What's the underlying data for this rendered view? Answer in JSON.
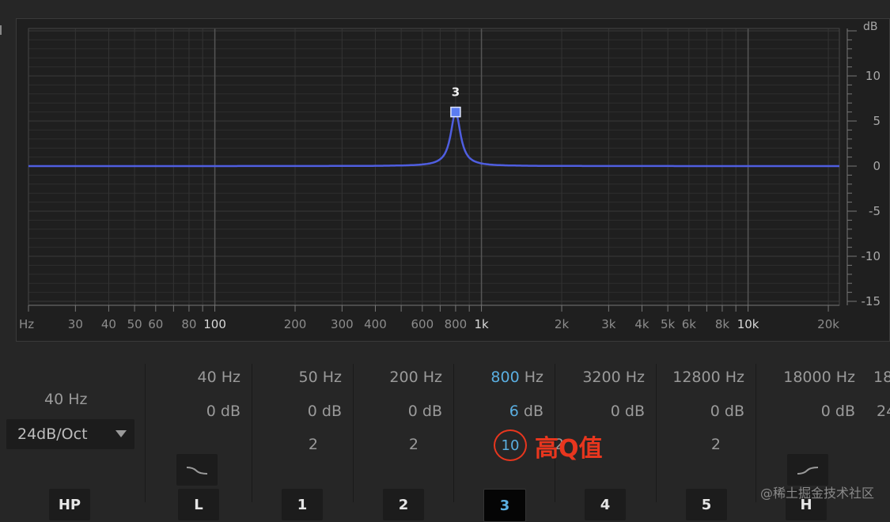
{
  "graph": {
    "db_unit": "dB",
    "db_ticks": [
      "10",
      "5",
      "0",
      "-5",
      "-10",
      "-15"
    ],
    "hz_unit": "Hz",
    "hz_ticks": [
      "30",
      "40",
      "50",
      "60",
      "80",
      "100",
      "200",
      "300",
      "400",
      "600",
      "800",
      "1k",
      "2k",
      "3k",
      "4k",
      "5k",
      "6k",
      "8k",
      "10k",
      "20k"
    ],
    "curve_color": "#4f5ee0",
    "node_label": "3"
  },
  "high_pass": {
    "freq": "40 Hz",
    "slope": "24dB/Oct",
    "button": "HP"
  },
  "bands": [
    {
      "freq_num": "40",
      "freq_unit": "Hz",
      "gain_num": "0",
      "gain_unit": "dB",
      "q": "",
      "button": "L",
      "shape": "low-shelf-icon"
    },
    {
      "freq_num": "50",
      "freq_unit": "Hz",
      "gain_num": "0",
      "gain_unit": "dB",
      "q": "2",
      "button": "1"
    },
    {
      "freq_num": "200",
      "freq_unit": "Hz",
      "gain_num": "0",
      "gain_unit": "dB",
      "q": "2",
      "button": "2"
    },
    {
      "freq_num": "800",
      "freq_unit": "Hz",
      "gain_num": "6",
      "gain_unit": "dB",
      "q": "10",
      "button": "3"
    },
    {
      "freq_num": "3200",
      "freq_unit": "Hz",
      "gain_num": "0",
      "gain_unit": "dB",
      "q": "2",
      "button": "4"
    },
    {
      "freq_num": "12800",
      "freq_unit": "Hz",
      "gain_num": "0",
      "gain_unit": "dB",
      "q": "2",
      "button": "5"
    },
    {
      "freq_num": "18000",
      "freq_unit": "Hz",
      "gain_num": "0",
      "gain_unit": "dB",
      "q": "",
      "button": "H",
      "shape": "high-shelf-icon"
    }
  ],
  "edge_partial": {
    "freq": "18",
    "slope": "24"
  },
  "annotation": {
    "q_value": "10",
    "text": "高Q值"
  },
  "watermark": "@稀土掘金技术社区",
  "colors": {
    "active": "#5aaee0",
    "annotation": "#e8361e",
    "background": "#262626"
  }
}
